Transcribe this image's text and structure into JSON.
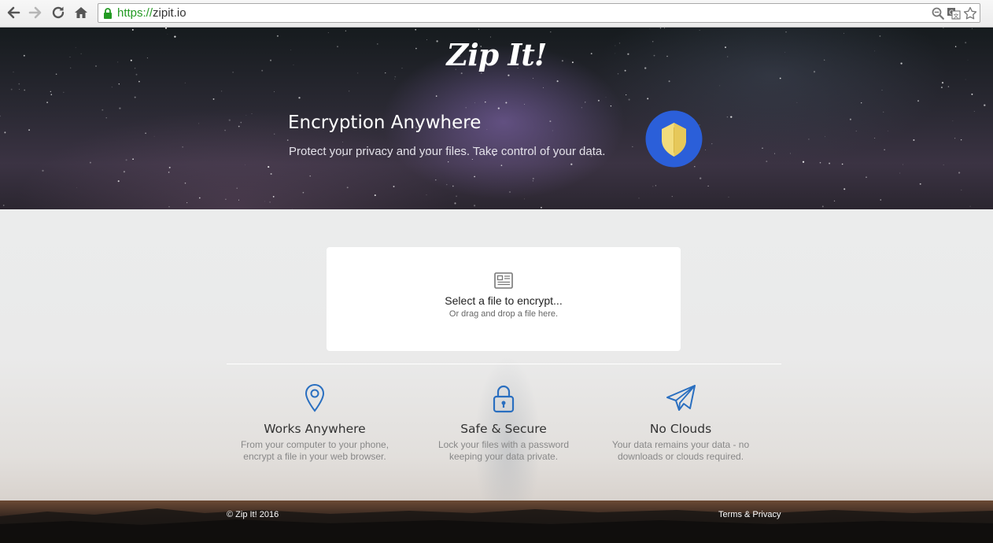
{
  "browser": {
    "url_scheme": "https://",
    "url_host": "zipit.io"
  },
  "hero": {
    "logo": "Zip It!",
    "title": "Encryption Anywhere",
    "subtitle": "Protect your privacy and your files. Take control of your data."
  },
  "dropzone": {
    "title": "Select a file to encrypt...",
    "subtitle": "Or drag and drop a file here."
  },
  "features": [
    {
      "title": "Works Anywhere",
      "description": "From your computer to your phone,\nencrypt a file in your web browser."
    },
    {
      "title": "Safe & Secure",
      "description": "Lock your files with a password\nkeeping your data private."
    },
    {
      "title": "No Clouds",
      "description": "Your data remains your data - no\ndownloads or clouds required."
    }
  ],
  "footer": {
    "copyright": "© Zip It! 2016",
    "terms": "Terms & Privacy"
  },
  "colors": {
    "accent_blue": "#2b5fd9",
    "shield_gold": "#f2dc7c",
    "icon_blue": "#2a6fc0",
    "secure_green": "#239a23"
  },
  "icons": {
    "back": "back-arrow-icon",
    "forward": "forward-arrow-icon",
    "reload": "reload-icon",
    "home": "home-icon",
    "lock": "lock-icon",
    "zoom": "zoom-icon",
    "translate": "translate-icon",
    "bookmark": "star-icon",
    "badge": "shield-icon",
    "file": "file-icon",
    "works_anywhere": "map-pin-icon",
    "safe_secure": "padlock-icon",
    "no_clouds": "paper-plane-icon"
  }
}
